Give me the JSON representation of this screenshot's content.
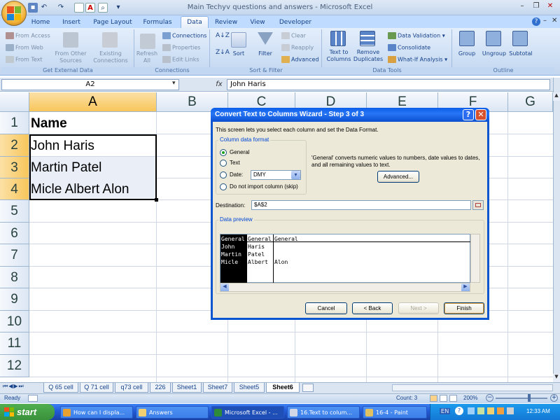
{
  "window": {
    "title": "Main Techyv questions and answers - Microsoft Excel"
  },
  "tabs": [
    "Home",
    "Insert",
    "Page Layout",
    "Formulas",
    "Data",
    "Review",
    "View",
    "Developer"
  ],
  "active_tab": "Data",
  "ribbon": {
    "get_external_data": {
      "label": "Get External Data",
      "items": [
        "From Access",
        "From Web",
        "From Text",
        "From Other Sources",
        "Existing Connections"
      ]
    },
    "connections": {
      "label": "Connections",
      "refresh": "Refresh All",
      "items": [
        "Connections",
        "Properties",
        "Edit Links"
      ]
    },
    "sort_filter": {
      "label": "Sort & Filter",
      "sort": "Sort",
      "filter": "Filter",
      "items": [
        "Clear",
        "Reapply",
        "Advanced"
      ]
    },
    "data_tools": {
      "label": "Data Tools",
      "text_to_columns": "Text to Columns",
      "remove_duplicates": "Remove Duplicates",
      "items": [
        "Data Validation",
        "Consolidate",
        "What-If Analysis"
      ]
    },
    "outline": {
      "label": "Outline",
      "items": [
        "Group",
        "Ungroup",
        "Subtotal"
      ]
    }
  },
  "formula_bar": {
    "name_box": "A2",
    "fx": "fx",
    "content": "John Haris"
  },
  "columns": [
    "A",
    "B",
    "C",
    "D",
    "E",
    "F",
    "G"
  ],
  "rows": [
    "1",
    "2",
    "3",
    "4",
    "5",
    "6",
    "7",
    "8",
    "9",
    "10",
    "11",
    "12"
  ],
  "cells": {
    "A1": "Name",
    "A2": "John Haris",
    "A3": "Martin Patel",
    "A4": "Micle Albert Alon"
  },
  "sheet_tabs": [
    "Q 65 cell",
    "Q 71 cell",
    "q73 cell",
    "226",
    "Sheet1",
    "Sheet7",
    "Sheet5",
    "Sheet6"
  ],
  "active_sheet": "Sheet6",
  "status": {
    "ready": "Ready",
    "count": "Count: 3",
    "zoom": "200%"
  },
  "dialog": {
    "title": "Convert Text to Columns Wizard - Step 3 of 3",
    "intro": "This screen lets you select each column and set the Data Format.",
    "column_format_label": "Column data format",
    "options": [
      "General",
      "Text",
      "Date:",
      "Do not import column (skip)"
    ],
    "selected_option": "General",
    "date_format": "DMY",
    "general_desc": "'General' converts numeric values to numbers, date values to dates, and all remaining values to text.",
    "advanced_button": "Advanced...",
    "destination_label": "Destination:",
    "destination_value": "$A$2",
    "preview_label": "Data preview",
    "preview_headers": [
      "General",
      "General",
      "General"
    ],
    "preview_rows": [
      [
        "John",
        "Haris",
        ""
      ],
      [
        "Martin",
        "Patel",
        ""
      ],
      [
        "Micle",
        "Albert",
        "Alon"
      ]
    ],
    "buttons": {
      "cancel": "Cancel",
      "back": "< Back",
      "next": "Next >",
      "finish": "Finish"
    }
  },
  "taskbar": {
    "start": "start",
    "tasks": [
      "How can I displa...",
      "Answers",
      "Microsoft Excel - ...",
      "16.Text to colum...",
      "16-4 - Paint"
    ],
    "active_task": "Microsoft Excel - ...",
    "tray": {
      "lang": "EN",
      "time": "12:33 AM"
    }
  }
}
